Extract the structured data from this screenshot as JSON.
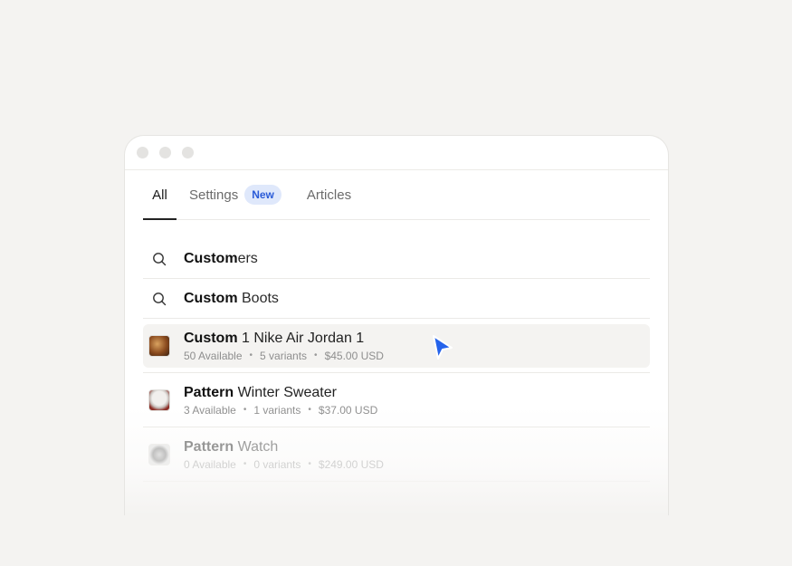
{
  "tabs": {
    "all": "All",
    "settings": "Settings",
    "settings_badge": "New",
    "articles": "Articles"
  },
  "suggestions": [
    {
      "bold": "Custom",
      "rest": "ers"
    },
    {
      "bold": "Custom",
      "rest": " Boots"
    }
  ],
  "products": [
    {
      "bold": "Custom",
      "rest": " 1 Nike Air Jordan 1",
      "available": "50 Available",
      "variants": "5 variants",
      "price": "$45.00 USD",
      "thumb": "sneaker-thumbnail"
    },
    {
      "bold": "Pattern",
      "rest": " Winter Sweater",
      "available": "3 Available",
      "variants": "1 variants",
      "price": "$37.00 USD",
      "thumb": "sweater-thumbnail"
    },
    {
      "bold": "Pattern",
      "rest": " Watch",
      "available": "0 Available",
      "variants": "0 variants",
      "price": "$249.00 USD",
      "thumb": "watch-thumbnail"
    }
  ],
  "icons": {
    "search": "search-icon",
    "cursor": "mouse-pointer-icon"
  },
  "colors": {
    "accent": "#2a5bd7",
    "badge_bg": "#dfe8fb",
    "cursor": "#2563eb"
  }
}
